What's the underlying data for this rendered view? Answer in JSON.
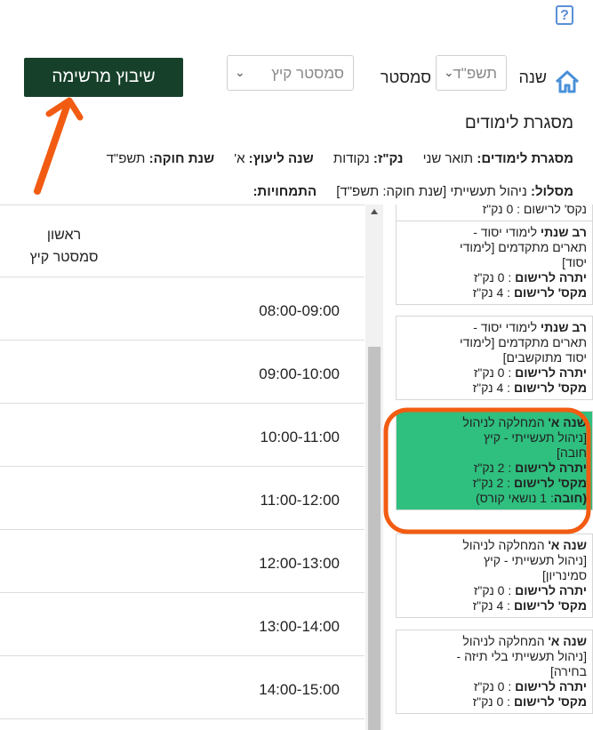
{
  "help": {
    "label": "?"
  },
  "filters": {
    "year_label": "שנה",
    "year_value": "תשפ\"ד",
    "semester_label": "סמסטר",
    "semester_value": "סמסטר קיץ",
    "build_button": "שיבוץ מרשימה"
  },
  "framework": {
    "title": "מסגרת לימודים",
    "info": [
      {
        "key": "מסגרת לימודים:",
        "value": "תואר שני"
      },
      {
        "key": "נק\"ז:",
        "value": "נקודות"
      },
      {
        "key": "שנה ליעוץ:",
        "value": "א'"
      },
      {
        "key": "שנת חוקה:",
        "value": "תשפ\"ד"
      }
    ],
    "track_key": "מסלול:",
    "track_value": "ניהול תעשייתי [שנת חוקה: תשפ\"ד]",
    "specializations_key": "התמחויות:"
  },
  "schedule": {
    "day": "ראשון",
    "semester": "סמסטר קיץ",
    "slots": [
      "08:00-09:00",
      "09:00-10:00",
      "10:00-11:00",
      "11:00-12:00",
      "12:00-13:00",
      "13:00-14:00",
      "14:00-15:00"
    ]
  },
  "courses": [
    {
      "lines": [
        {
          "b": "",
          "t": "נקס' לרישום : 0 נק\"ז"
        }
      ]
    },
    {
      "lines": [
        {
          "b": "רב שנתי",
          "t": " לימודי יסוד -"
        },
        {
          "b": "",
          "t": "תארים מתקדמים [לימודי"
        },
        {
          "b": "",
          "t": "יסוד]"
        },
        {
          "b": "יתרה לרישום",
          "t": " : 0 נק\"ז"
        },
        {
          "b": "מקס' לרישום",
          "t": " : 4 נק\"ז"
        }
      ]
    },
    {
      "lines": [
        {
          "b": "רב שנתי",
          "t": " לימודי יסוד -"
        },
        {
          "b": "",
          "t": "תארים מתקדמים [לימודי"
        },
        {
          "b": "",
          "t": "יסוד מתוקשבים]"
        },
        {
          "b": "יתרה לרישום",
          "t": " : 0 נק\"ז"
        },
        {
          "b": "מקס' לרישום",
          "t": " : 4 נק\"ז"
        }
      ]
    },
    {
      "active": true,
      "lines": [
        {
          "b": "שנה א'",
          "t": " המחלקה לניהול"
        },
        {
          "b": "",
          "t": "[ניהול תעשייתי - קיץ"
        },
        {
          "b": "",
          "t": "חובה]"
        },
        {
          "b": "יתרה לרישום",
          "t": " : 2 נק\"ז"
        },
        {
          "b": "מקס' לרישום",
          "t": " : 2 נק\"ז"
        },
        {
          "b": "(חובה",
          "t": ": 1 נושאי קורס)"
        }
      ]
    },
    {
      "lines": [
        {
          "b": "שנה א'",
          "t": " המחלקה לניהול"
        },
        {
          "b": "",
          "t": "[ניהול תעשייתי - קיץ"
        },
        {
          "b": "",
          "t": "סמינריון]"
        },
        {
          "b": "יתרה לרישום",
          "t": " : 0 נק\"ז"
        },
        {
          "b": "מקס' לרישום",
          "t": " : 4 נק\"ז"
        }
      ]
    },
    {
      "lines": [
        {
          "b": "שנה א'",
          "t": " המחלקה לניהול"
        },
        {
          "b": "",
          "t": "[ניהול תעשייתי בלי תיזה -"
        },
        {
          "b": "",
          "t": "בחירה]"
        },
        {
          "b": "יתרה לרישום",
          "t": " : 0 נק\"ז"
        },
        {
          "b": "מקס' לרישום",
          "t": " : 0 נק\"ז"
        }
      ]
    }
  ],
  "colors": {
    "primary_button": "#17402b",
    "active_card": "#2fbf7f",
    "annotation": "#f25c12",
    "home_icon": "#4a90d9"
  }
}
